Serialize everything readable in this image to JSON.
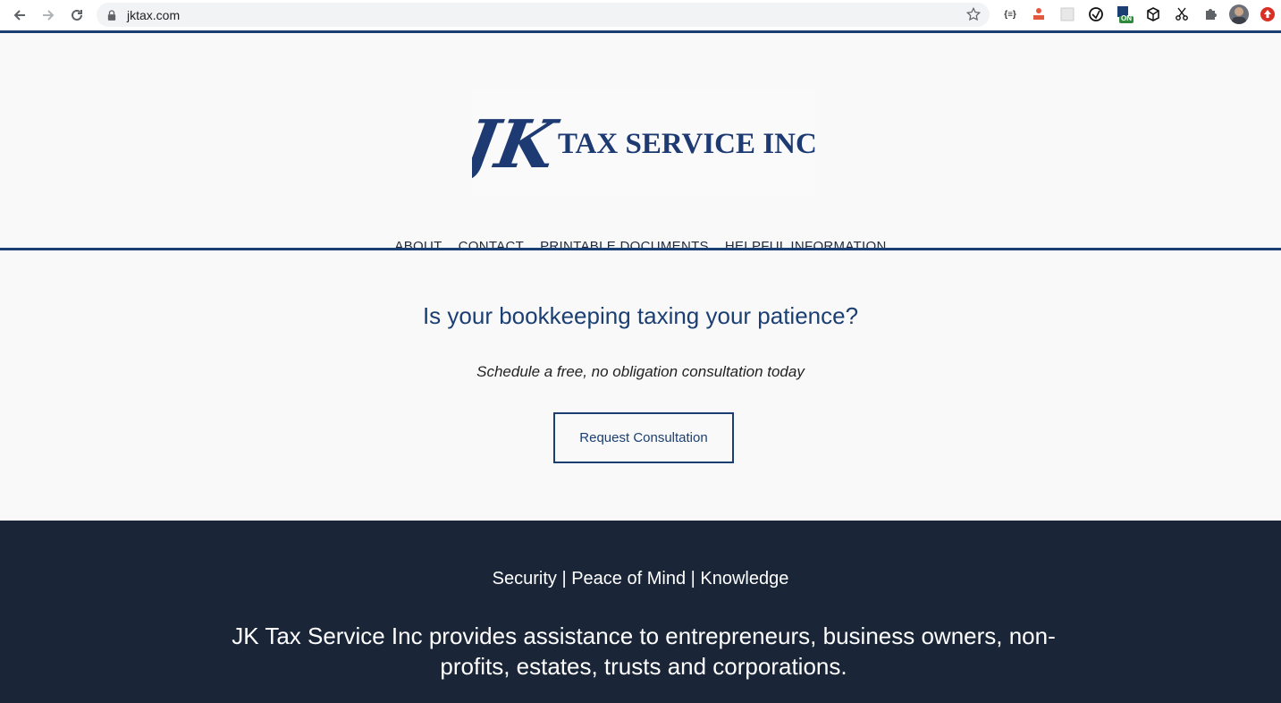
{
  "browser": {
    "url": "jktax.com",
    "extension_badge": "ON"
  },
  "logo": {
    "monogram": "JK",
    "name": "TAX SERVICE INC."
  },
  "nav": {
    "items": [
      {
        "label": "ABOUT"
      },
      {
        "label": "CONTACT"
      },
      {
        "label": "PRINTABLE DOCUMENTS"
      },
      {
        "label": "HELPFUL INFORMATION"
      }
    ]
  },
  "hero": {
    "headline": "Is your bookkeeping taxing your patience?",
    "subline": "Schedule a free, no obligation consultation today",
    "cta_label": "Request Consultation"
  },
  "band": {
    "tagline": "Security | Peace of Mind | Knowledge",
    "description": "JK Tax Service Inc provides assistance to entrepreneurs, business owners, non-profits, estates, trusts and corporations."
  },
  "colors": {
    "brand_navy": "#1b3f73",
    "band_background": "#1a2638",
    "page_background": "#f9f9f9"
  },
  "icons": [
    "back-icon",
    "forward-icon",
    "reload-icon",
    "lock-icon",
    "star-icon",
    "extensions-puzzle-icon",
    "profile-avatar"
  ]
}
